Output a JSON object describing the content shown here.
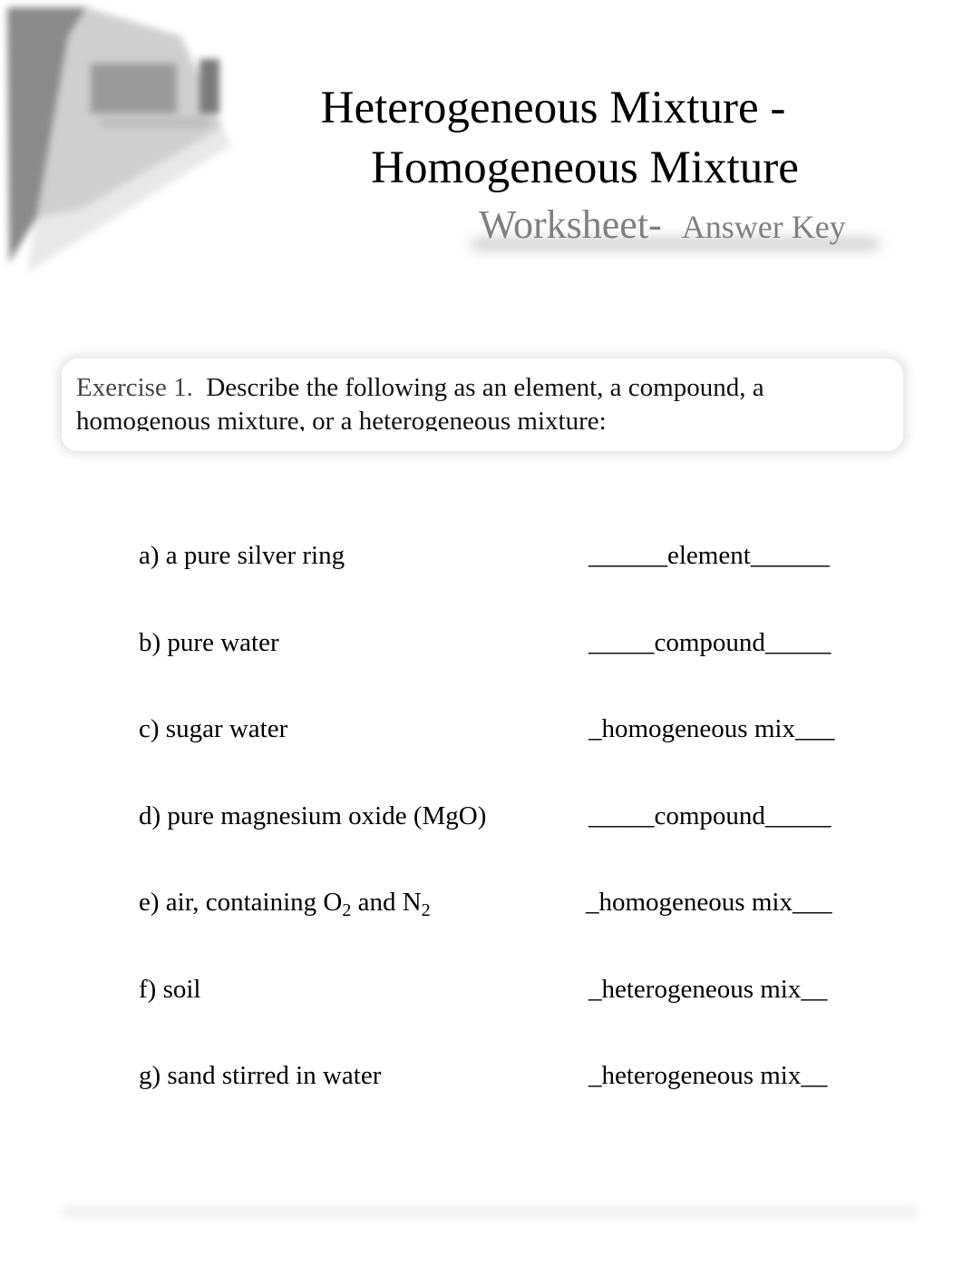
{
  "logo": {
    "icon": "publisher-logo-icon"
  },
  "title": {
    "line1": "Heterogeneous Mixture -",
    "line2": "Homogeneous Mixture"
  },
  "subtitle": {
    "worksheet": "Worksheet-",
    "answer_key": "Answer Key"
  },
  "exercise": {
    "label": "Exercise 1.",
    "instruction": "Describe the following as an element, a compound, a homogenous mixture, or a heterogeneous mixture:"
  },
  "questions": [
    {
      "letter": "a)",
      "text": "a pure silver ring",
      "answer": "______element______"
    },
    {
      "letter": "b)",
      "text": "pure water",
      "answer": "_____compound_____"
    },
    {
      "letter": "c)",
      "text": "sugar water",
      "answer": "_homogeneous mix___"
    },
    {
      "letter": "d)",
      "text": "pure magnesium oxide (MgO)",
      "answer": "_____compound_____"
    },
    {
      "letter": "e)",
      "text_before": "air, containing O",
      "sub1": "2",
      "text_mid": " and N",
      "sub2": "2",
      "answer": "_homogeneous mix___"
    },
    {
      "letter": "f)",
      "text": "soil",
      "answer": "_heterogeneous mix__"
    },
    {
      "letter": "g)",
      "text": "sand stirred in water",
      "answer": "_heterogeneous mix__"
    }
  ]
}
